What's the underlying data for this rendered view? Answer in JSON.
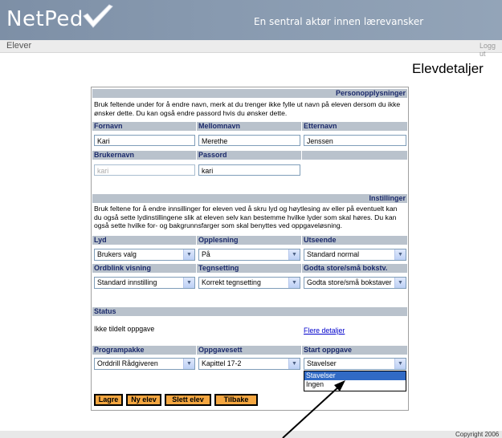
{
  "header": {
    "logo_text": "NetPed",
    "tagline": "En sentral aktør innen lærevansker",
    "nav_link": "Elever",
    "logout": "Logg ut"
  },
  "page_title": "Elevdetaljer",
  "personal": {
    "section_title": "Personopplysninger",
    "description": "Bruk feltende under for å endre navn, merk at du trenger ikke fylle ut navn på eleven dersom du ikke ønsker dette. Du kan også endre passord hvis du ønsker dette.",
    "first_name_label": "Fornavn",
    "first_name": "Kari",
    "middle_name_label": "Mellomnavn",
    "middle_name": "Merethe",
    "last_name_label": "Etternavn",
    "last_name": "Jenssen",
    "username_label": "Brukernavn",
    "username": "kari",
    "password_label": "Passord",
    "password": "kari"
  },
  "settings": {
    "section_title": "Instillinger",
    "description": "Bruk feltene for å endre innsillinger for eleven ved å skru lyd og høytlesing av eller på eventuelt kan du også sette lydinstillingene slik at eleven selv kan bestemme hvilke lyder som skal høres. Du kan også sette hvilke for- og bakgrunnsfarger som skal benyttes ved oppgaveløsning.",
    "sound_label": "Lyd",
    "sound_value": "Brukers valg",
    "readout_label": "Opplesning",
    "readout_value": "På",
    "appearance_label": "Utseende",
    "appearance_value": "Standard normal",
    "ordblink_label": "Ordblink visning",
    "ordblink_value": "Standard innstilling",
    "punctuation_label": "Tegnsetting",
    "punctuation_value": "Korrekt tegnsetting",
    "case_label": "Godta store/små bokstv.",
    "case_value": "Godta store/små bokstaver"
  },
  "status": {
    "section_title": "Status",
    "text": "Ikke tildelt oppgave",
    "more_link": "Flere detaljer"
  },
  "assignment": {
    "package_label": "Programpakke",
    "package_value": "Orddrill Rådgiveren",
    "set_label": "Oppgavesett",
    "set_value": "Kapittel 17-2",
    "start_label": "Start oppgave",
    "start_value": "Stavelser",
    "start_options": [
      "Stavelser",
      "Ingen"
    ]
  },
  "buttons": {
    "save": "Lagre",
    "new": "Ny elev",
    "delete": "Slett elev",
    "back": "Tilbake"
  },
  "footer": {
    "copyright": "Copyright 2006"
  },
  "colors": {
    "banner": "#8799af",
    "section_header": "#b9c2cc",
    "header_text": "#1b2a6b",
    "button": "#f4a640",
    "selection": "#316ac5"
  }
}
